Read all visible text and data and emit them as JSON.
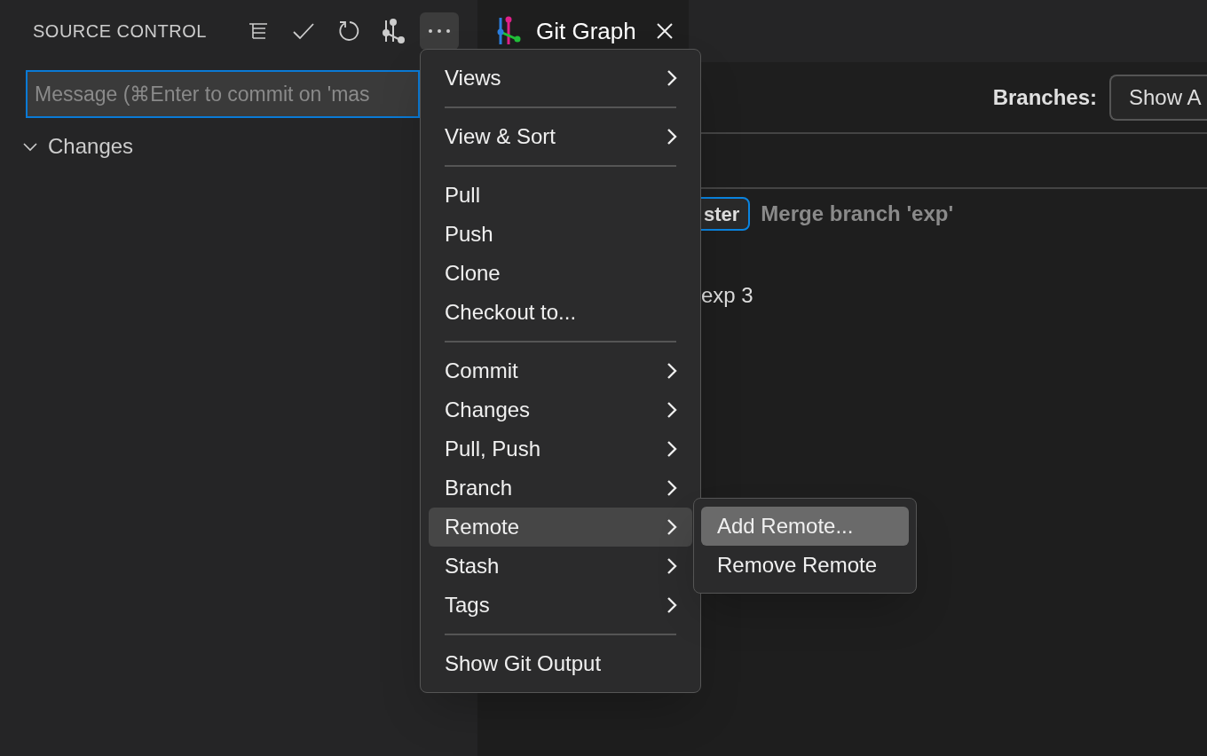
{
  "sidebar": {
    "title": "SOURCE CONTROL",
    "more_open": true,
    "message_input": {
      "placeholder": "Message (⌘Enter to commit on 'mas"
    },
    "sections": [
      {
        "label": "Changes",
        "expanded": true
      }
    ]
  },
  "tabs": [
    {
      "label": "Git Graph",
      "selected": true
    }
  ],
  "git_graph": {
    "branches_label": "Branches:",
    "branches_dropdown": "Show A",
    "commits": [
      {
        "tag": "ster",
        "message": "Merge branch 'exp'"
      },
      {
        "message": "exp 3"
      }
    ]
  },
  "menu": {
    "items": [
      {
        "kind": "item",
        "label": "Views",
        "submenu": true,
        "selected": false
      },
      {
        "kind": "separator"
      },
      {
        "kind": "item",
        "label": "View & Sort",
        "submenu": true,
        "selected": false
      },
      {
        "kind": "separator"
      },
      {
        "kind": "item",
        "label": "Pull",
        "submenu": false,
        "selected": false
      },
      {
        "kind": "item",
        "label": "Push",
        "submenu": false,
        "selected": false
      },
      {
        "kind": "item",
        "label": "Clone",
        "submenu": false,
        "selected": false
      },
      {
        "kind": "item",
        "label": "Checkout to...",
        "submenu": false,
        "selected": false
      },
      {
        "kind": "separator"
      },
      {
        "kind": "item",
        "label": "Commit",
        "submenu": true,
        "selected": false
      },
      {
        "kind": "item",
        "label": "Changes",
        "submenu": true,
        "selected": false
      },
      {
        "kind": "item",
        "label": "Pull, Push",
        "submenu": true,
        "selected": false
      },
      {
        "kind": "item",
        "label": "Branch",
        "submenu": true,
        "selected": false
      },
      {
        "kind": "item",
        "label": "Remote",
        "submenu": true,
        "selected": true
      },
      {
        "kind": "item",
        "label": "Stash",
        "submenu": true,
        "selected": false
      },
      {
        "kind": "item",
        "label": "Tags",
        "submenu": true,
        "selected": false
      },
      {
        "kind": "separator"
      },
      {
        "kind": "item",
        "label": "Show Git Output",
        "submenu": false,
        "selected": false
      }
    ]
  },
  "submenu": {
    "items": [
      {
        "label": "Add Remote...",
        "selected": true
      },
      {
        "label": "Remove Remote",
        "selected": false
      }
    ]
  }
}
